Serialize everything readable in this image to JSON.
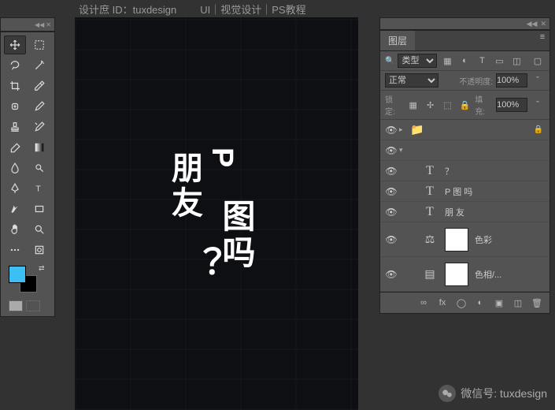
{
  "header": {
    "credit": "设计庶 ID：tuxdesign",
    "subtitle": "UI｜视觉设计｜PS教程"
  },
  "tools": {
    "items": [
      "move",
      "marquee",
      "lasso",
      "magic-wand",
      "crop",
      "eyedropper",
      "healing",
      "brush",
      "stamp",
      "history-brush",
      "eraser",
      "gradient",
      "blur",
      "dodge",
      "pen",
      "type",
      "path",
      "rectangle",
      "hand",
      "zoom",
      "more",
      "quick"
    ]
  },
  "swatches": {
    "fg": "#3dbff3",
    "bg": "#000000"
  },
  "canvas": {
    "t1": "朋友",
    "t2": "P",
    "t3": "？",
    "t4": "图吗"
  },
  "layers_panel": {
    "tab": "图层",
    "filter_label": "类型",
    "blend": "正常",
    "opacity_label": "不透明度:",
    "opacity_value": "100%",
    "lock_label": "锁定:",
    "fill_label": "填充:",
    "fill_value": "100%",
    "layers": [
      {
        "visible": true,
        "disclosure": ">",
        "kind": "folder",
        "name": "",
        "locked": true
      },
      {
        "visible": true,
        "disclosure": "v",
        "kind": "group",
        "name": ""
      },
      {
        "visible": true,
        "kind": "text",
        "name": "？",
        "indent": 2
      },
      {
        "visible": true,
        "kind": "text",
        "name": "P 图 吗",
        "indent": 2
      },
      {
        "visible": true,
        "kind": "text",
        "name": "朋 友",
        "indent": 2
      },
      {
        "visible": true,
        "kind": "adjust",
        "name": "色彩",
        "indent": 2,
        "thumb": true,
        "fxicon": "balance"
      },
      {
        "visible": true,
        "kind": "adjust",
        "name": "色相/...",
        "indent": 2,
        "thumb": true,
        "fxicon": "hue"
      }
    ]
  },
  "watermark": {
    "label": "微信号: tuxdesign"
  }
}
